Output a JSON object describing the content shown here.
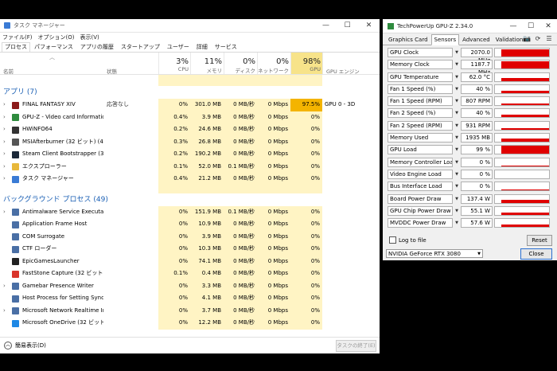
{
  "taskmanager": {
    "title": "タスク マネージャー",
    "window_controls": [
      "—",
      "☐",
      "✕"
    ],
    "menu": [
      "ファイル(F)",
      "オプション(O)",
      "表示(V)"
    ],
    "tabs": [
      "プロセス",
      "パフォーマンス",
      "アプリの履歴",
      "スタートアップ",
      "ユーザー",
      "詳細",
      "サービス"
    ],
    "headers": {
      "name": "名前",
      "status": "状態",
      "cpu_pct": "3%",
      "cpu": "CPU",
      "mem_pct": "11%",
      "mem": "メモリ",
      "disk_pct": "0%",
      "disk": "ディスク",
      "net_pct": "0%",
      "net": "ネットワーク",
      "gpu_pct": "98%",
      "gpu": "GPU",
      "engine": "GPU エンジン"
    },
    "apps_section": "アプリ (7)",
    "apps": [
      {
        "name": "FINAL FANTASY XIV",
        "status": "応答なし",
        "cpu": "0%",
        "mem": "301.0 MB",
        "disk": "0 MB/秒",
        "net": "0 Mbps",
        "gpu": "97.5%",
        "engine": "GPU 0 - 3D",
        "color": "#8b1a1a"
      },
      {
        "name": "GPU-Z - Video card Information...",
        "status": "",
        "cpu": "0.4%",
        "mem": "3.9 MB",
        "disk": "0 MB/秒",
        "net": "0 Mbps",
        "gpu": "0%",
        "engine": "",
        "color": "#2e8b3e"
      },
      {
        "name": "HWiNFO64",
        "status": "",
        "cpu": "0.2%",
        "mem": "24.6 MB",
        "disk": "0 MB/秒",
        "net": "0 Mbps",
        "gpu": "0%",
        "engine": "",
        "color": "#333333"
      },
      {
        "name": "MSIAfterburner (32 ビット) (4)",
        "status": "",
        "cpu": "0.3%",
        "mem": "26.8 MB",
        "disk": "0 MB/秒",
        "net": "0 Mbps",
        "gpu": "0%",
        "engine": "",
        "color": "#555555"
      },
      {
        "name": "Steam Client Bootstrapper (32 ビ...",
        "status": "",
        "cpu": "0.2%",
        "mem": "190.2 MB",
        "disk": "0 MB/秒",
        "net": "0 Mbps",
        "gpu": "0%",
        "engine": "",
        "color": "#1b2838"
      },
      {
        "name": "エクスプローラー",
        "status": "",
        "cpu": "0.1%",
        "mem": "52.0 MB",
        "disk": "0.1 MB/秒",
        "net": "0 Mbps",
        "gpu": "0%",
        "engine": "",
        "color": "#e8b83a"
      },
      {
        "name": "タスク マネージャー",
        "status": "",
        "cpu": "0.4%",
        "mem": "21.2 MB",
        "disk": "0 MB/秒",
        "net": "0 Mbps",
        "gpu": "0%",
        "engine": "",
        "color": "#3a7bd5"
      }
    ],
    "bg_section": "バックグラウンド プロセス (49)",
    "bg": [
      {
        "name": "Antimalware Service Executable",
        "cpu": "0%",
        "mem": "151.9 MB",
        "disk": "0.1 MB/秒",
        "net": "0 Mbps",
        "gpu": "0%",
        "color": "#4a6fa5",
        "expand": true
      },
      {
        "name": "Application Frame Host",
        "cpu": "0%",
        "mem": "10.9 MB",
        "disk": "0 MB/秒",
        "net": "0 Mbps",
        "gpu": "0%",
        "color": "#4a6fa5",
        "expand": false
      },
      {
        "name": "COM Surrogate",
        "cpu": "0%",
        "mem": "3.9 MB",
        "disk": "0 MB/秒",
        "net": "0 Mbps",
        "gpu": "0%",
        "color": "#4a6fa5",
        "expand": false
      },
      {
        "name": "CTF ローダー",
        "cpu": "0%",
        "mem": "10.3 MB",
        "disk": "0 MB/秒",
        "net": "0 Mbps",
        "gpu": "0%",
        "color": "#4a6fa5",
        "expand": false
      },
      {
        "name": "EpicGamesLauncher",
        "cpu": "0%",
        "mem": "74.1 MB",
        "disk": "0 MB/秒",
        "net": "0 Mbps",
        "gpu": "0%",
        "color": "#222222",
        "expand": false
      },
      {
        "name": "FastStone Capture (32 ビット)",
        "cpu": "0.1%",
        "mem": "0.4 MB",
        "disk": "0 MB/秒",
        "net": "0 Mbps",
        "gpu": "0%",
        "color": "#d9342b",
        "expand": false
      },
      {
        "name": "Gamebar Presence Writer",
        "cpu": "0%",
        "mem": "3.3 MB",
        "disk": "0 MB/秒",
        "net": "0 Mbps",
        "gpu": "0%",
        "color": "#4a6fa5",
        "expand": true
      },
      {
        "name": "Host Process for Setting Synch...",
        "cpu": "0%",
        "mem": "4.1 MB",
        "disk": "0 MB/秒",
        "net": "0 Mbps",
        "gpu": "0%",
        "color": "#4a6fa5",
        "expand": false
      },
      {
        "name": "Microsoft Network Realtime Ins...",
        "cpu": "0%",
        "mem": "3.7 MB",
        "disk": "0 MB/秒",
        "net": "0 Mbps",
        "gpu": "0%",
        "color": "#4a6fa5",
        "expand": true
      },
      {
        "name": "Microsoft OneDrive (32 ビット)",
        "cpu": "0%",
        "mem": "12.2 MB",
        "disk": "0 MB/秒",
        "net": "0 Mbps",
        "gpu": "0%",
        "color": "#1e88e5",
        "expand": false
      }
    ],
    "less_details": "簡易表示(D)",
    "end_task": "タスクの終了(E)"
  },
  "gpuz": {
    "title": "TechPowerUp GPU-Z 2.34.0",
    "window_controls": [
      "—",
      "☐",
      "✕"
    ],
    "tabs": [
      "Graphics Card",
      "Sensors",
      "Advanced",
      "Validation"
    ],
    "active_tab": 1,
    "tools": [
      "📷",
      "⟳",
      "☰"
    ],
    "sensors": [
      {
        "name": "GPU Clock",
        "value": "2070.0 MHz",
        "level": 0.9
      },
      {
        "name": "Memory Clock",
        "value": "1187.7 MHz",
        "level": 0.85
      },
      {
        "name": "GPU Temperature",
        "value": "62.0 °C",
        "level": 0.35
      },
      {
        "name": "Fan 1 Speed (%)",
        "value": "40 %",
        "level": 0.3
      },
      {
        "name": "Fan 1 Speed (RPM)",
        "value": "807 RPM",
        "level": 0.2
      },
      {
        "name": "Fan 2 Speed (%)",
        "value": "40 %",
        "level": 0.3
      },
      {
        "name": "Fan 2 Speed (RPM)",
        "value": "931 RPM",
        "level": 0.2
      },
      {
        "name": "Memory Used",
        "value": "1935 MB",
        "level": 0.35
      },
      {
        "name": "GPU Load",
        "value": "99 %",
        "level": 0.95
      },
      {
        "name": "Memory Controller Load",
        "value": "0 %",
        "level": 0.12
      },
      {
        "name": "Video Engine Load",
        "value": "0 %",
        "level": 0
      },
      {
        "name": "Bus Interface Load",
        "value": "0 %",
        "level": 0.05
      },
      {
        "name": "Board Power Draw",
        "value": "137.4 W",
        "level": 0.4
      },
      {
        "name": "GPU Chip Power Draw",
        "value": "55.1 W",
        "level": 0.3
      },
      {
        "name": "MVDDC Power Draw",
        "value": "57.6 W",
        "level": 0.3
      }
    ],
    "log_label": "Log to file",
    "reset_label": "Reset",
    "gpu_name": "NVIDIA GeForce RTX 3080",
    "close_label": "Close"
  }
}
